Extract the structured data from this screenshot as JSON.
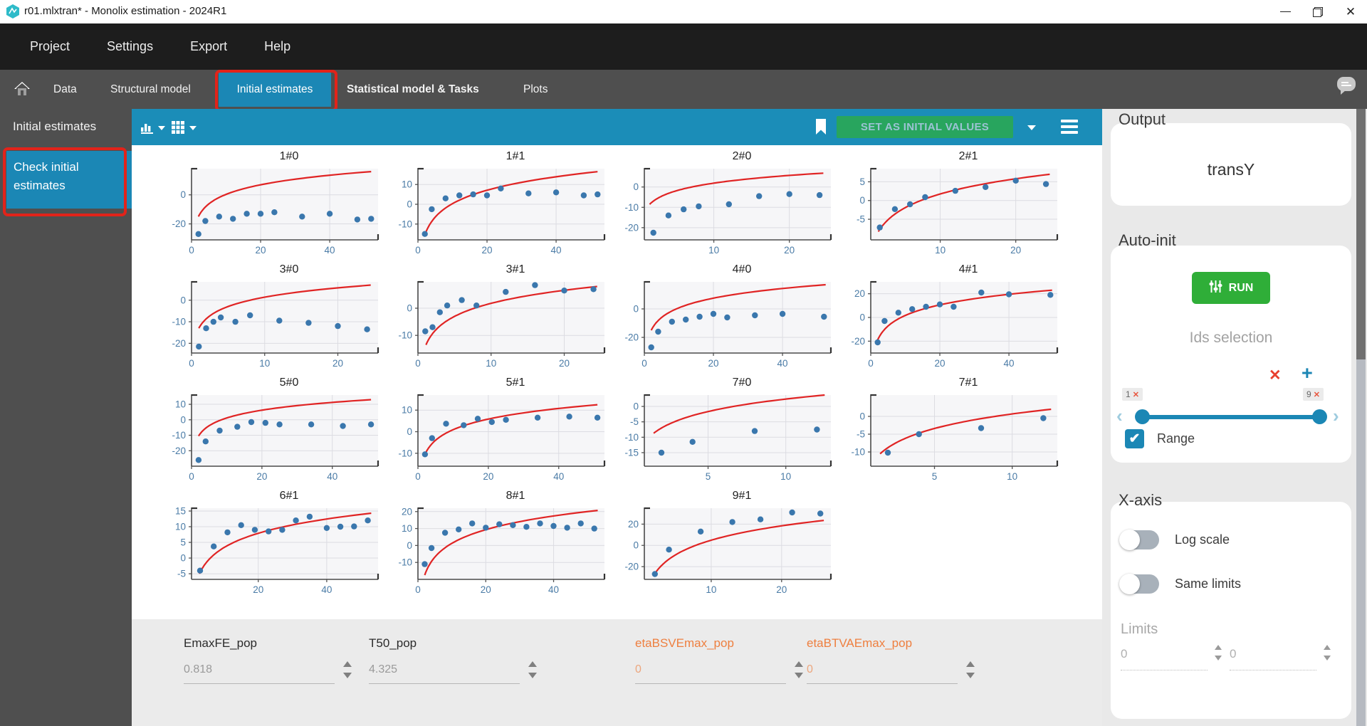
{
  "window": {
    "title": "r01.mlxtran* - Monolix estimation - 2024R1",
    "controls": [
      "minimize",
      "restore",
      "close"
    ]
  },
  "menu": {
    "items": [
      "Project",
      "Settings",
      "Export",
      "Help"
    ]
  },
  "tabs": {
    "items": [
      {
        "label": "Data"
      },
      {
        "label": "Structural model"
      },
      {
        "label": "Initial estimates",
        "active": true,
        "highlighted": true
      },
      {
        "label": "Statistical model & Tasks",
        "bold": true
      },
      {
        "label": "Plots"
      }
    ]
  },
  "sidebar": {
    "title": "Initial estimates",
    "items": [
      {
        "label": "Check initial estimates",
        "active": true,
        "highlighted": true
      }
    ]
  },
  "toolbar": {
    "set_button": "SET AS INITIAL VALUES"
  },
  "icons": {
    "logo": "teal-gem",
    "home": "house",
    "chat": "speech-bubble",
    "chart_type": "bar-chart",
    "layout": "grid",
    "bookmark": "bookmark",
    "menu": "hamburger",
    "run": "sliders",
    "remove": "x",
    "add": "+"
  },
  "colors": {
    "accent_blue": "#1b87b5",
    "toolbar_blue": "#1b8db8",
    "tab_gray": "#4f4f4f",
    "menu_dark": "#1d1d1d",
    "annotation_red": "#e2231a",
    "set_green": "#28a55e",
    "run_green": "#2fae38",
    "orange": "#ee7f3f",
    "curve_red": "#e02424",
    "point_blue": "#3a77ad",
    "tick_blue": "#4a7ba6",
    "panel_gray": "#e9e9e9"
  },
  "plots": [
    {
      "name": "1#0",
      "xlim": [
        0,
        54
      ],
      "ylim": [
        -31,
        18
      ],
      "xticks": [
        0,
        20,
        40
      ],
      "yticks": [
        0,
        -20
      ],
      "curve": [
        2,
        -15,
        52,
        16
      ],
      "points": [
        [
          2,
          -27
        ],
        [
          4,
          -18
        ],
        [
          8,
          -15
        ],
        [
          12,
          -16.5
        ],
        [
          16,
          -13
        ],
        [
          20,
          -13
        ],
        [
          24,
          -12
        ],
        [
          32,
          -15
        ],
        [
          40,
          -13
        ],
        [
          48,
          -17
        ],
        [
          52,
          -16.5
        ]
      ]
    },
    {
      "name": "1#1",
      "xlim": [
        0,
        54
      ],
      "ylim": [
        -18,
        18
      ],
      "xticks": [
        0,
        20,
        40
      ],
      "yticks": [
        10,
        0,
        -10
      ],
      "curve": [
        2,
        -15.5,
        52,
        16.5
      ],
      "points": [
        [
          2,
          -15
        ],
        [
          4,
          -2.5
        ],
        [
          8,
          3
        ],
        [
          12,
          4.5
        ],
        [
          16,
          5
        ],
        [
          20,
          4.5
        ],
        [
          24,
          8
        ],
        [
          32,
          5.5
        ],
        [
          40,
          6
        ],
        [
          48,
          4.5
        ],
        [
          52,
          5
        ]
      ]
    },
    {
      "name": "2#0",
      "xlim": [
        0.8,
        25.5
      ],
      "ylim": [
        -26,
        9
      ],
      "xticks": [
        10,
        20
      ],
      "yticks": [
        0,
        -10,
        -20
      ],
      "curve": [
        1.5,
        -8.5,
        24.5,
        6.8
      ],
      "points": [
        [
          2,
          -22.5
        ],
        [
          4,
          -14
        ],
        [
          6,
          -11
        ],
        [
          8,
          -9.5
        ],
        [
          12,
          -8.5
        ],
        [
          16,
          -4.5
        ],
        [
          20,
          -3.5
        ],
        [
          24,
          -4
        ]
      ]
    },
    {
      "name": "2#1",
      "xlim": [
        0.8,
        25.5
      ],
      "ylim": [
        -10.5,
        8.5
      ],
      "xticks": [
        10,
        20
      ],
      "yticks": [
        5,
        0,
        -5
      ],
      "curve": [
        1.8,
        -8.3,
        24.5,
        7
      ],
      "points": [
        [
          2,
          -7.2
        ],
        [
          4,
          -2.3
        ],
        [
          6,
          -1
        ],
        [
          8,
          0.9
        ],
        [
          12,
          2.6
        ],
        [
          16,
          3.6
        ],
        [
          20,
          5.3
        ],
        [
          24,
          4.4
        ]
      ]
    },
    {
      "name": "3#0",
      "xlim": [
        0,
        25.5
      ],
      "ylim": [
        -24.5,
        8.5
      ],
      "xticks": [
        0,
        10,
        20
      ],
      "yticks": [
        0,
        -10,
        -20
      ],
      "curve": [
        1,
        -13,
        24.5,
        7
      ],
      "points": [
        [
          1,
          -21.5
        ],
        [
          2,
          -13
        ],
        [
          3,
          -10
        ],
        [
          4,
          -8
        ],
        [
          6,
          -10
        ],
        [
          8,
          -7
        ],
        [
          12,
          -9.5
        ],
        [
          16,
          -10.5
        ],
        [
          20,
          -12
        ],
        [
          24,
          -13.5
        ]
      ]
    },
    {
      "name": "3#1",
      "xlim": [
        0,
        25.5
      ],
      "ylim": [
        -16.5,
        9.7
      ],
      "xticks": [
        0,
        10,
        20
      ],
      "yticks": [
        0,
        -10
      ],
      "curve": [
        1.1,
        -13.5,
        24.5,
        8
      ],
      "points": [
        [
          1,
          -8.5
        ],
        [
          2,
          -7
        ],
        [
          3,
          -1.5
        ],
        [
          4,
          1
        ],
        [
          6,
          3
        ],
        [
          8,
          1
        ],
        [
          12,
          6
        ],
        [
          16,
          8.5
        ],
        [
          20,
          6.5
        ],
        [
          24,
          7
        ]
      ]
    },
    {
      "name": "4#0",
      "xlim": [
        0,
        54
      ],
      "ylim": [
        -31,
        19
      ],
      "xticks": [
        0,
        20,
        40
      ],
      "yticks": [
        0,
        -20
      ],
      "curve": [
        2,
        -15,
        52.5,
        17
      ],
      "points": [
        [
          2,
          -27
        ],
        [
          4,
          -16
        ],
        [
          8,
          -9
        ],
        [
          12,
          -7.5
        ],
        [
          16,
          -5.5
        ],
        [
          20,
          -3.5
        ],
        [
          24,
          -6
        ],
        [
          32,
          -4.5
        ],
        [
          40,
          -3.5
        ],
        [
          52,
          -5.5
        ]
      ]
    },
    {
      "name": "4#1",
      "xlim": [
        0,
        54
      ],
      "ylim": [
        -30,
        30
      ],
      "xticks": [
        0,
        20,
        40
      ],
      "yticks": [
        20,
        0,
        -20
      ],
      "curve": [
        2,
        -19,
        52.5,
        23
      ],
      "points": [
        [
          2,
          -21
        ],
        [
          4,
          -3
        ],
        [
          8,
          4
        ],
        [
          12,
          7
        ],
        [
          16,
          9
        ],
        [
          20,
          11
        ],
        [
          24,
          9
        ],
        [
          32,
          21
        ],
        [
          40,
          19.5
        ],
        [
          52,
          19
        ]
      ]
    },
    {
      "name": "5#0",
      "xlim": [
        0,
        53
      ],
      "ylim": [
        -30,
        16
      ],
      "xticks": [
        0,
        20,
        40
      ],
      "yticks": [
        10,
        0,
        -10,
        -20
      ],
      "curve": [
        2,
        -10.5,
        51,
        13
      ],
      "points": [
        [
          2,
          -26
        ],
        [
          4,
          -14
        ],
        [
          8,
          -7
        ],
        [
          13,
          -4.5
        ],
        [
          17,
          -1.5
        ],
        [
          21,
          -2
        ],
        [
          25,
          -3
        ],
        [
          34,
          -3
        ],
        [
          43,
          -4
        ],
        [
          51,
          -3
        ]
      ]
    },
    {
      "name": "5#1",
      "xlim": [
        0,
        53
      ],
      "ylim": [
        -16,
        17
      ],
      "xticks": [
        0,
        20,
        40
      ],
      "yticks": [
        10,
        0,
        -10
      ],
      "curve": [
        2,
        -10.5,
        51,
        12.5
      ],
      "points": [
        [
          2,
          -10.5
        ],
        [
          4,
          -3
        ],
        [
          8,
          3.7
        ],
        [
          13,
          3
        ],
        [
          17,
          6
        ],
        [
          21,
          4.5
        ],
        [
          25,
          5.5
        ],
        [
          34,
          6.5
        ],
        [
          43,
          7
        ],
        [
          51,
          6.5
        ]
      ]
    },
    {
      "name": "7#0",
      "xlim": [
        0.9,
        12.9
      ],
      "ylim": [
        -19.4,
        3.7
      ],
      "xticks": [
        5,
        10
      ],
      "yticks": [
        0,
        -5,
        -10,
        -15
      ],
      "curve": [
        1.5,
        -8.7,
        12.5,
        3.7
      ],
      "points": [
        [
          2,
          -15
        ],
        [
          4,
          -11.5
        ],
        [
          8,
          -8
        ],
        [
          12,
          -7.5
        ]
      ]
    },
    {
      "name": "7#1",
      "xlim": [
        0.9,
        12.9
      ],
      "ylim": [
        -14,
        6
      ],
      "xticks": [
        5,
        10
      ],
      "yticks": [
        0,
        -5,
        -10
      ],
      "curve": [
        1.5,
        -10.5,
        12.5,
        2
      ],
      "points": [
        [
          2,
          -10.2
        ],
        [
          4,
          -5
        ],
        [
          8,
          -3.3
        ],
        [
          12,
          -0.5
        ]
      ]
    },
    {
      "name": "6#1",
      "xlim": [
        0.5,
        55
      ],
      "ylim": [
        -6.8,
        15.9
      ],
      "xticks": [
        20,
        40
      ],
      "yticks": [
        15,
        10,
        5,
        0,
        -5
      ],
      "curve": [
        2.8,
        -5,
        53,
        14.3
      ],
      "points": [
        [
          3,
          -4
        ],
        [
          7,
          3.7
        ],
        [
          11,
          8.2
        ],
        [
          15,
          10.5
        ],
        [
          19,
          9
        ],
        [
          23,
          8.5
        ],
        [
          27,
          9
        ],
        [
          31,
          12
        ],
        [
          35,
          13.2
        ],
        [
          40,
          9.6
        ],
        [
          44,
          10
        ],
        [
          48,
          10.1
        ],
        [
          52,
          12
        ]
      ]
    },
    {
      "name": "8#1",
      "xlim": [
        0,
        55
      ],
      "ylim": [
        -20,
        22
      ],
      "xticks": [
        0,
        20,
        40
      ],
      "yticks": [
        20,
        10,
        0,
        -10
      ],
      "curve": [
        2,
        -17.5,
        53,
        20.7
      ],
      "points": [
        [
          2,
          -11
        ],
        [
          4,
          -1.5
        ],
        [
          8,
          7.5
        ],
        [
          12,
          9.5
        ],
        [
          16,
          13
        ],
        [
          20,
          10.5
        ],
        [
          24,
          12.5
        ],
        [
          28,
          12
        ],
        [
          32,
          11
        ],
        [
          36,
          13
        ],
        [
          40,
          11.5
        ],
        [
          44,
          10.5
        ],
        [
          48,
          13
        ],
        [
          52,
          10
        ]
      ]
    },
    {
      "name": "9#1",
      "xlim": [
        0.5,
        27
      ],
      "ylim": [
        -32,
        35
      ],
      "xticks": [
        10,
        20
      ],
      "yticks": [
        20,
        0,
        -20
      ],
      "curve": [
        2,
        -26.5,
        26,
        23.5
      ],
      "points": [
        [
          2,
          -27
        ],
        [
          4,
          -4
        ],
        [
          8.5,
          13
        ],
        [
          13,
          22
        ],
        [
          17,
          24.5
        ],
        [
          21.5,
          31
        ],
        [
          25.5,
          30
        ]
      ]
    }
  ],
  "params": {
    "items": [
      {
        "name": "EmaxFE_pop",
        "value": "0.818",
        "style": "gray"
      },
      {
        "name": "T50_pop",
        "value": "4.325",
        "style": "gray"
      },
      {
        "name": "etaBSVEmax_pop",
        "value": "0",
        "style": "orange"
      },
      {
        "name": "etaBTVAEmax_pop",
        "value": "0",
        "style": "orange"
      }
    ]
  },
  "right_panel": {
    "output": {
      "title": "Output",
      "value": "transY"
    },
    "auto_init": {
      "title": "Auto-init",
      "run_label": "RUN",
      "ids_label": "Ids selection",
      "range_label": "Range",
      "range_checked": true,
      "slider": {
        "min_tag": "1",
        "max_tag": "9"
      }
    },
    "x_axis": {
      "title": "X-axis",
      "log_scale_label": "Log scale",
      "log_scale_on": false,
      "same_limits_label": "Same limits",
      "same_limits_on": false,
      "limits_label": "Limits",
      "limit_inputs": [
        "0",
        "0"
      ]
    }
  }
}
